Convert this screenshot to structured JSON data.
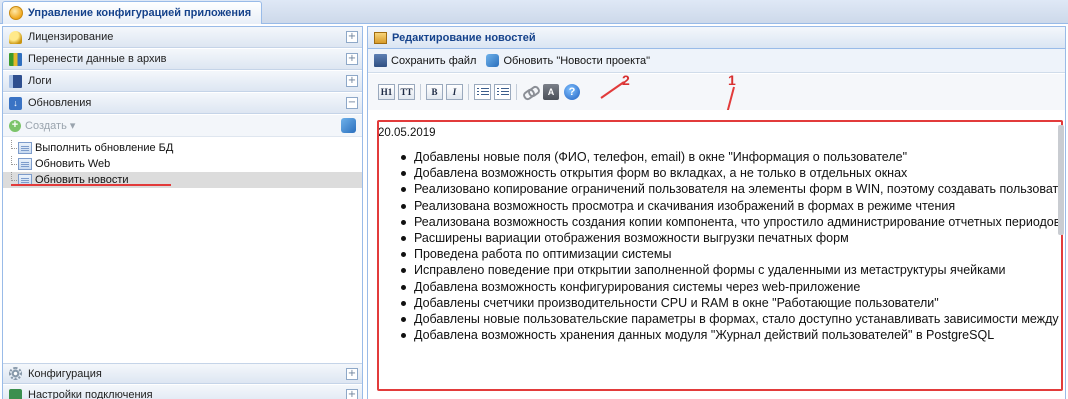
{
  "app": {
    "tab_title": "Управление конфигурацией приложения"
  },
  "sidebar": {
    "sections_top": [
      {
        "label": "Лицензирование",
        "icon": "key-icon",
        "toggle": "+"
      },
      {
        "label": "Перенести данные в архив",
        "icon": "archive-icon",
        "toggle": "+"
      },
      {
        "label": "Логи",
        "icon": "logs-icon",
        "toggle": "+"
      },
      {
        "label": "Обновления",
        "icon": "update-icon",
        "toggle": "−"
      }
    ],
    "create_label": "Создать",
    "tree_items": [
      {
        "label": "Выполнить обновление БД",
        "selected": false
      },
      {
        "label": "Обновить Web",
        "selected": false
      },
      {
        "label": "Обновить новости",
        "selected": true
      }
    ],
    "sections_bottom": [
      {
        "label": "Конфигурация",
        "icon": "config-icon",
        "toggle": "+"
      },
      {
        "label": "Настройки подключения",
        "icon": "connection-icon",
        "toggle": "+"
      }
    ]
  },
  "main": {
    "panel_title": "Редактирование новостей",
    "toolbar": {
      "save_label": "Сохранить файл",
      "refresh_label": "Обновить \"Новости проекта\""
    },
    "editor_buttons": {
      "h1": "H1",
      "tt": "TT",
      "bold": "B",
      "italic": "I",
      "source": "A",
      "help": "?"
    },
    "annotations": {
      "label_1": "1",
      "label_2": "2"
    },
    "content": {
      "date": "20.05.2019",
      "items": [
        "Добавлены новые поля (ФИО, телефон, email) в окне  \"Информация о пользователе\"",
        "Добавлена возможность открытия форм во вкладках, а не  только в отдельных окнах",
        "Реализовано копирование ограничений пользователя на  элементы форм в WIN, поэтому создавать пользовател",
        "Реализована возможность просмотра и скачивания  изображений в формах в режиме чтения",
        "Реализована возможность создания копии компонента,  что упростило администрирование отчетных периодов",
        "Расширены вариации отображения возможности выгрузки  печатных форм",
        "Проведена работа по оптимизации системы",
        "Исправлено поведение при открытии заполненной формы  с удаленными из метаструктуры ячейками",
        "Добавлена возможность конфигурирования системы через  web-приложение",
        "Добавлены счетчики производительности CPU и RAM в  окне \"Работающие пользователи\"",
        "Добавлены новые пользовательские параметры в формах,  стало доступно устанавливать зависимости между",
        "Добавлена возможность хранения данных модуля \"Журнал  действий пользователей\" в PostgreSQL"
      ]
    }
  },
  "colors": {
    "annotation_red": "#e23b3b",
    "header_text": "#15428b",
    "panel_border": "#99bbe8"
  }
}
